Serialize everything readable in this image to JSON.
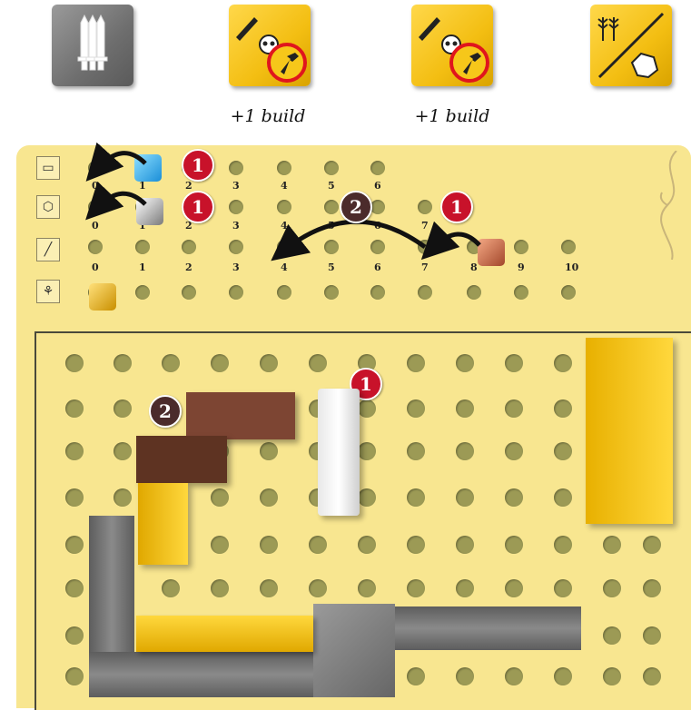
{
  "top_tiles": [
    {
      "name": "swords-tile",
      "color": "#7d7d7d"
    },
    {
      "name": "attack-build-tile-1",
      "caption": "+1 build"
    },
    {
      "name": "attack-build-tile-2",
      "caption": "+1 build"
    },
    {
      "name": "wheat-or-stone-tile"
    }
  ],
  "tracks": {
    "row1_numbers": [
      "0",
      "1",
      "2",
      "3",
      "4",
      "5",
      "6"
    ],
    "row2_numbers": [
      "0",
      "1",
      "2",
      "3",
      "4",
      "5",
      "6",
      "7"
    ],
    "row3_numbers": [
      "0",
      "1",
      "2",
      "3",
      "4",
      "5",
      "6",
      "7",
      "8",
      "9",
      "10"
    ]
  },
  "badges": {
    "one": "1",
    "two": "2"
  },
  "colors": {
    "board": "#f8e690",
    "red_badge": "#c8122a",
    "dark_badge": "#4b2b2b",
    "hole": "#9c9a55"
  }
}
